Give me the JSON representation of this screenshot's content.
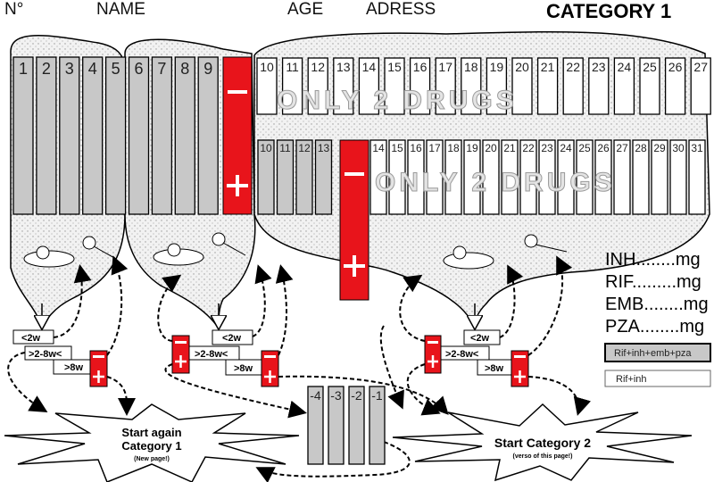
{
  "header": {
    "number": "N°",
    "name": "NAME",
    "age": "AGE",
    "address": "ADRESS",
    "category": "CATEGORY 1"
  },
  "group1_columns": [
    "1",
    "2",
    "3",
    "4",
    "5",
    "6",
    "7",
    "8",
    "9"
  ],
  "row1_white_columns": [
    "10",
    "11",
    "12",
    "13",
    "14",
    "15",
    "16",
    "17",
    "18",
    "19",
    "20",
    "21",
    "22",
    "23",
    "24",
    "25",
    "26",
    "27"
  ],
  "row2_gray_columns": [
    "10",
    "11",
    "12",
    "13"
  ],
  "row2_white_columns": [
    "14",
    "15",
    "16",
    "17",
    "18",
    "19",
    "20",
    "21",
    "22",
    "23",
    "24",
    "25",
    "26",
    "27",
    "28",
    "29",
    "30",
    "31"
  ],
  "watermark": "ONLY 2 DRUGS",
  "timing": {
    "lt2": "<2w",
    "mid": ">2-8w<",
    "gt8": ">8w"
  },
  "drugs": [
    "INH........mg",
    "RIF.........mg",
    "EMB........mg",
    "PZA........mg"
  ],
  "legend": {
    "four_drugs": "Rif+inh+emb+pza",
    "two_drugs": "Rif+inh"
  },
  "negative_columns": [
    "-4",
    "-3",
    "-2",
    "-1"
  ],
  "star1": {
    "line1": "Start again",
    "line2": "Category 1",
    "note": "(New    page!)"
  },
  "star2": {
    "title": "Start Category 2",
    "note": "(verso of this page!)"
  },
  "colors": {
    "red": "#e8141b",
    "gray": "#c8c8c8",
    "blob": "#e6e6e6"
  }
}
